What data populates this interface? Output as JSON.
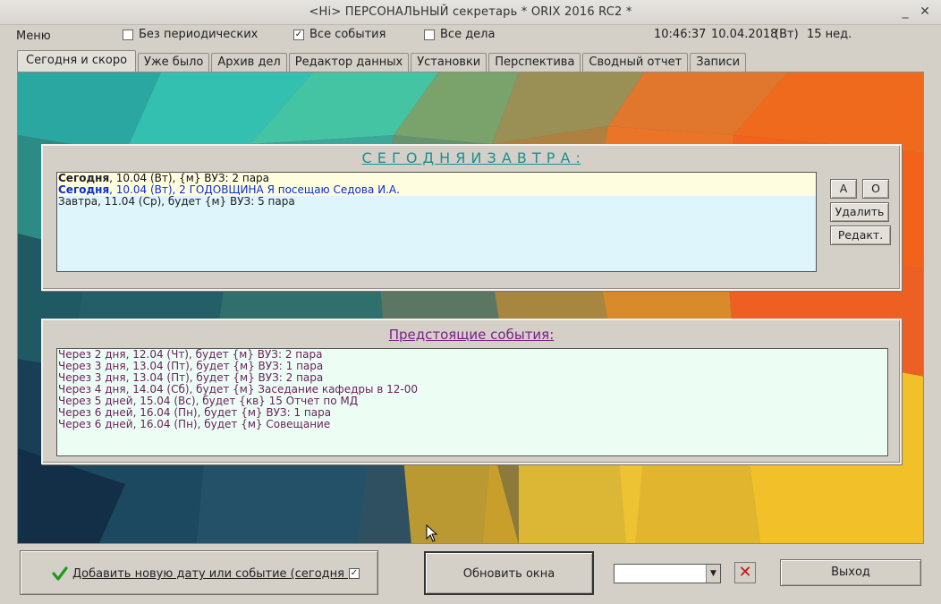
{
  "window": {
    "title": "<Hi>        ПЕРСОНАЛЬНЫЙ секретарь   * ORIX 2016 RC2 *",
    "minimize": "_",
    "close": "✕"
  },
  "menu": {
    "label": "Меню"
  },
  "filters": {
    "no_periodic": {
      "label": "Без периодических",
      "checked": false
    },
    "all_events": {
      "label": "Все события",
      "checked": true
    },
    "all_tasks": {
      "label": "Все дела",
      "checked": false
    }
  },
  "status": {
    "time": "10:46:37",
    "date": "10.04.2018",
    "weekday": "(Вт)",
    "week": "15 нед."
  },
  "tabs": [
    {
      "label": "Сегодня и скоро",
      "active": true
    },
    {
      "label": "Уже было"
    },
    {
      "label": "Архив дел"
    },
    {
      "label": "Редактор данных"
    },
    {
      "label": "Установки"
    },
    {
      "label": "Перспектива"
    },
    {
      "label": "Сводный отчет"
    },
    {
      "label": "Записи"
    }
  ],
  "today_panel": {
    "title": "С Е Г О Д Н Я   И   З А В Т Р А :",
    "rows": [
      {
        "prefix": "Сегодня",
        "text": ", 10.04 (Вт), {м} ВУЗ: 2 пара",
        "style": "bold-today",
        "highlight": true
      },
      {
        "prefix": "Сегодня",
        "text": ", 10.04 (Вт), 2  ГОДОВЩИНА Я посещаю Седова И.А.",
        "style": "blue",
        "highlight": true
      },
      {
        "prefix": "Завтра",
        "text": ", 11.04 (Ср), будет {м} ВУЗ: 5 пара",
        "style": "normal",
        "highlight": false
      }
    ],
    "buttons": {
      "a": "А",
      "o": "О",
      "delete": "Удалить",
      "edit": "Редакт."
    }
  },
  "upcoming_panel": {
    "title": "Предстоящие события:    ",
    "rows": [
      "Через   2 дня, 12.04 (Чт), будет {м} ВУЗ: 2 пара",
      "Через   3 дня, 13.04 (Пт), будет {м} ВУЗ: 1 пара",
      "Через   3 дня, 13.04 (Пт), будет {м} ВУЗ: 2 пара",
      "Через   4 дня, 14.04 (Сб), будет {м} Заседание кафедры в 12-00",
      "Через   5 дней, 15.04 (Вс), будет {кв} 15 Отчет по МД",
      "Через   6 дней, 16.04 (Пн), будет {м} ВУЗ: 1 пара",
      "Через   6 дней, 16.04 (Пн), будет {м} Совещание"
    ]
  },
  "bottom": {
    "add_label": "Добавить новую дату или событие  (сегодня    )",
    "add_checked": true,
    "refresh_label": "Обновить окна",
    "combo_value": "",
    "exit_label": "Выход"
  },
  "colors": {
    "today_highlight": "#fffde0",
    "upcoming_bg": "#ecfdf4",
    "upcoming_text": "#6b1f5c",
    "title_teal": "#1e8f8f",
    "title_purple": "#7a1f86",
    "blue": "#0a2fd0"
  }
}
